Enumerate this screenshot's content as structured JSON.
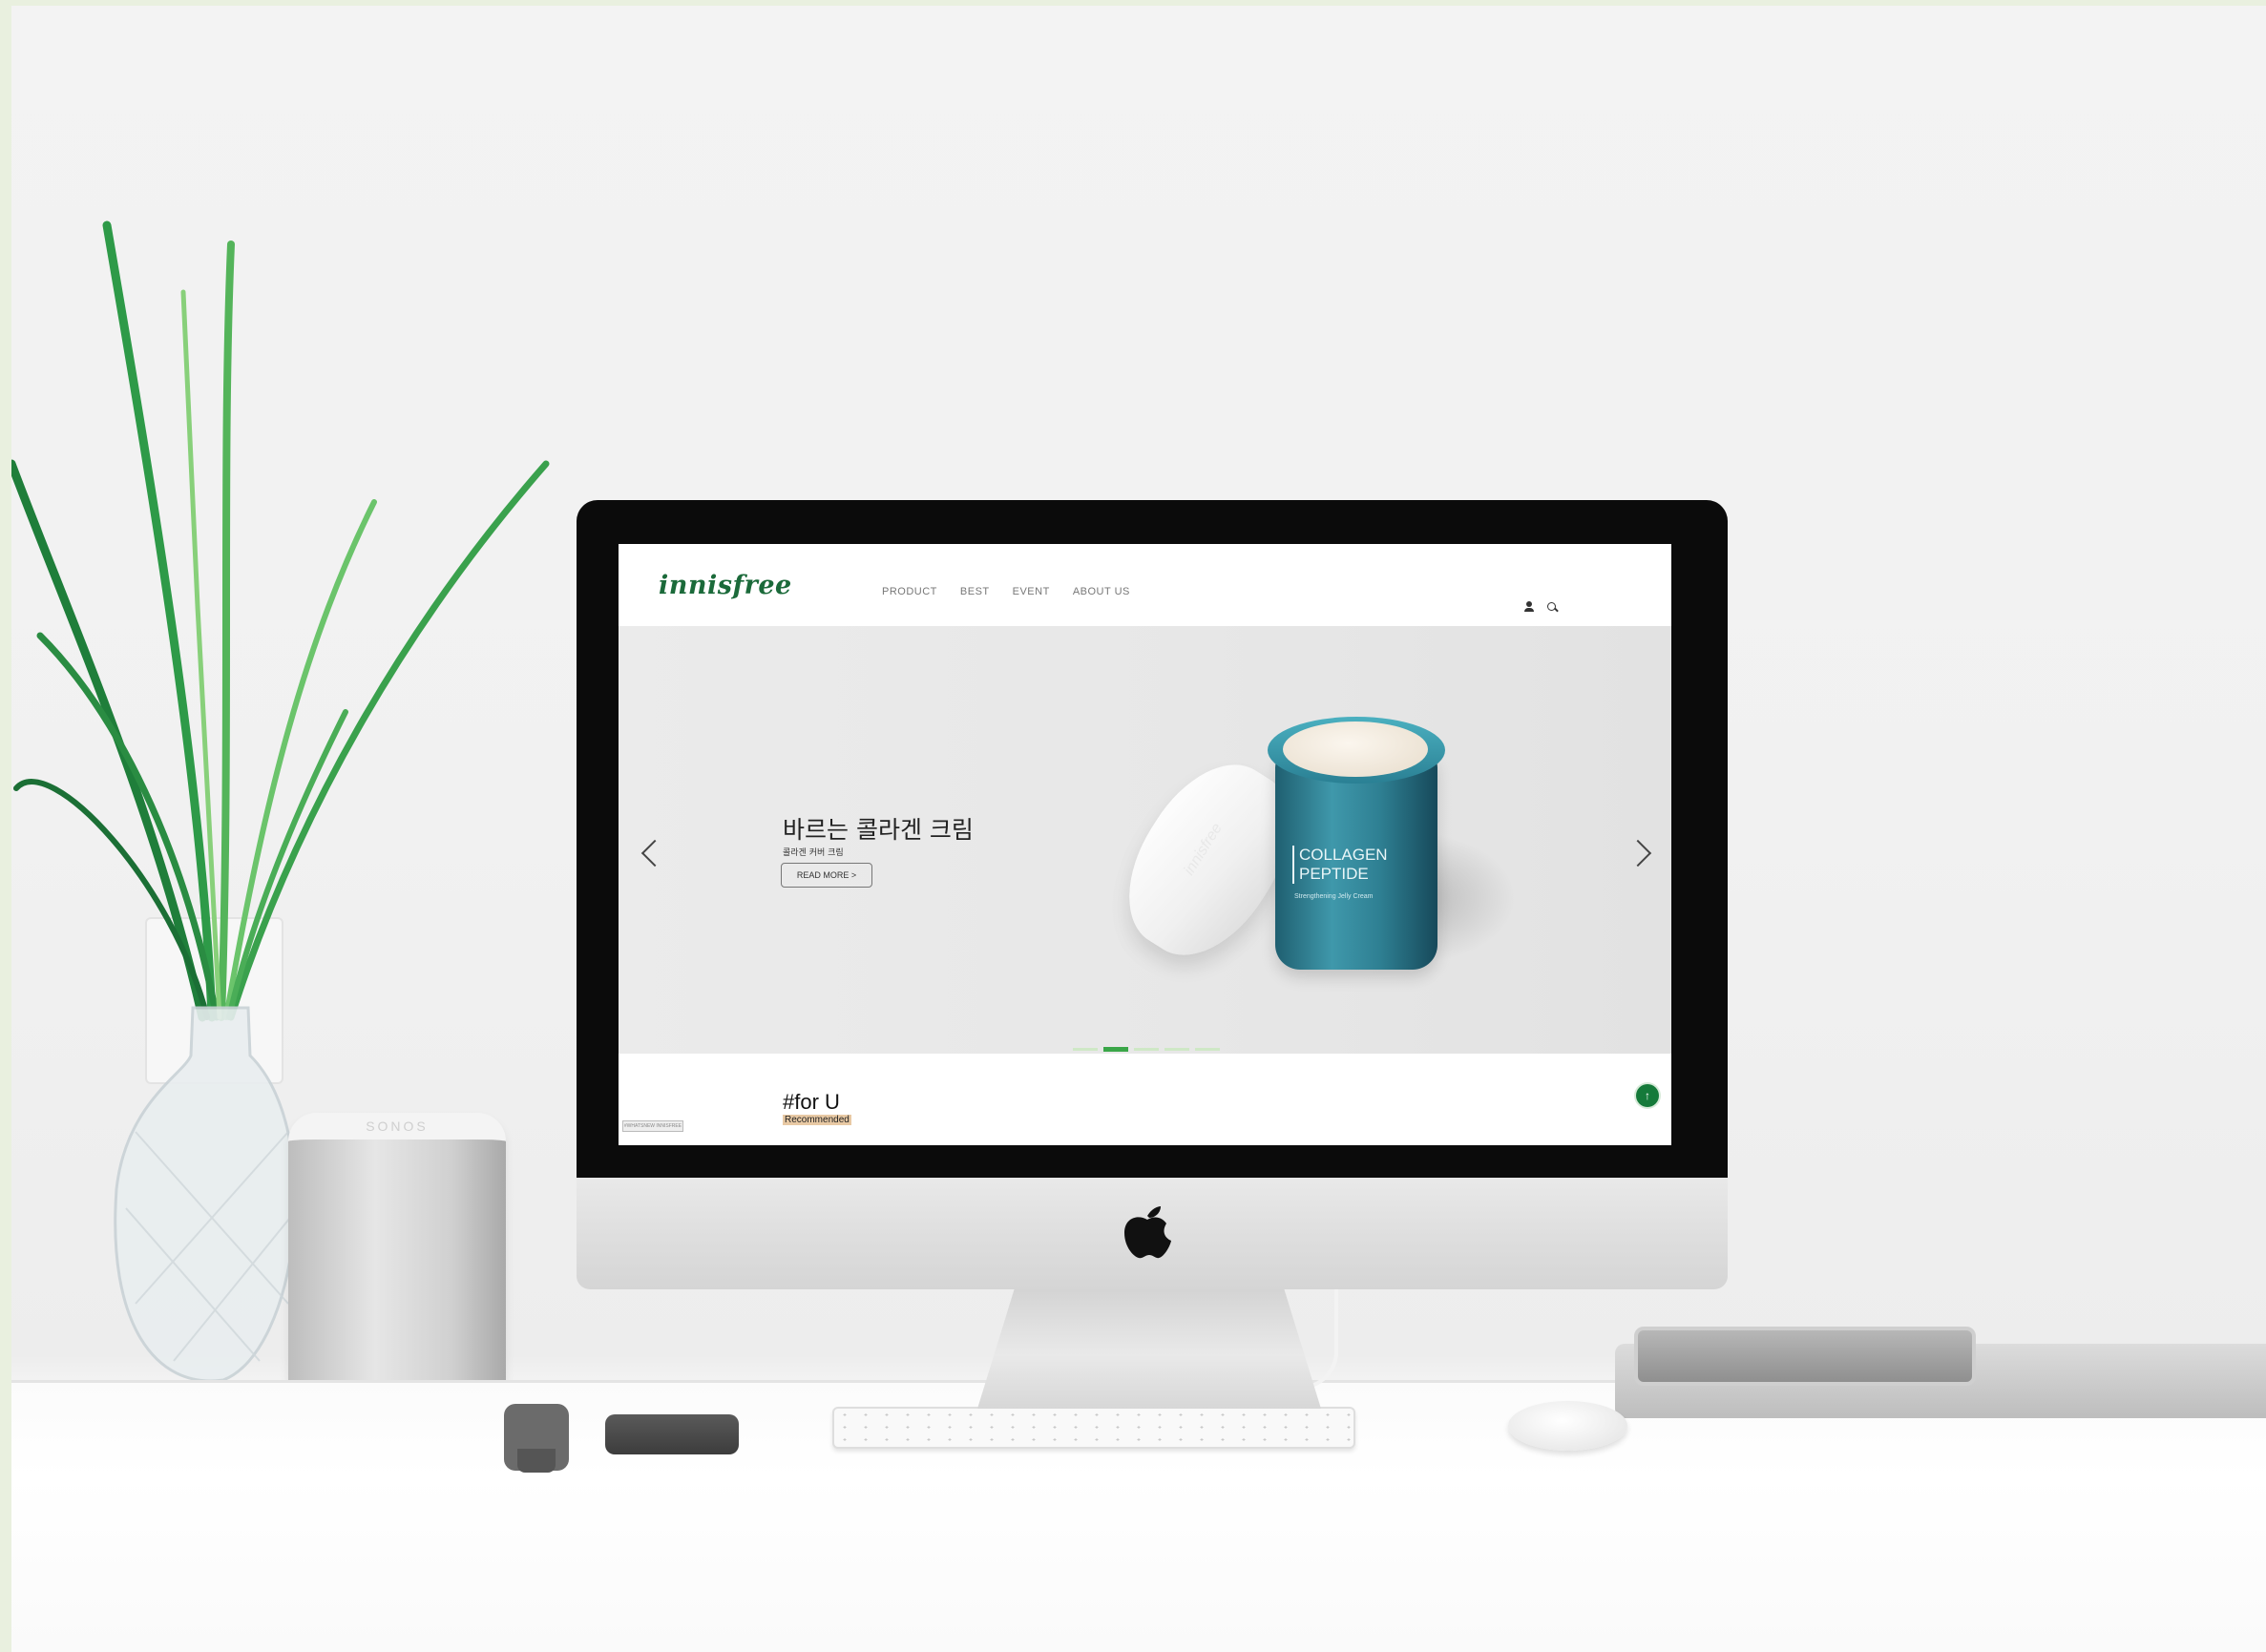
{
  "site": {
    "logo": "innisfree",
    "nav": [
      "PRODUCT",
      "BEST",
      "EVENT",
      "ABOUT US"
    ],
    "icons": [
      "user-icon",
      "search-icon"
    ]
  },
  "hero": {
    "title": "바르는 콜라겐 크림",
    "subtitle": "콜라겐 커버 크림",
    "readmore": "READ MORE >",
    "product_label_line1": "COLLAGEN",
    "product_label_line2": "PEPTIDE",
    "product_label_sub": "Strengthening Jelly Cream",
    "lid_brand": "innisfree",
    "slides": 5,
    "active_slide": 2
  },
  "section": {
    "title": "#for U",
    "subtitle": "Recommended",
    "badge": "#WHATSNEW INNISFREE"
  },
  "scene": {
    "speaker_brand": "SONOS",
    "apple_logo": ""
  },
  "colors": {
    "brand_green": "#1b6a3a",
    "accent_green": "#3aa648",
    "jar_teal": "#2e7f92"
  }
}
